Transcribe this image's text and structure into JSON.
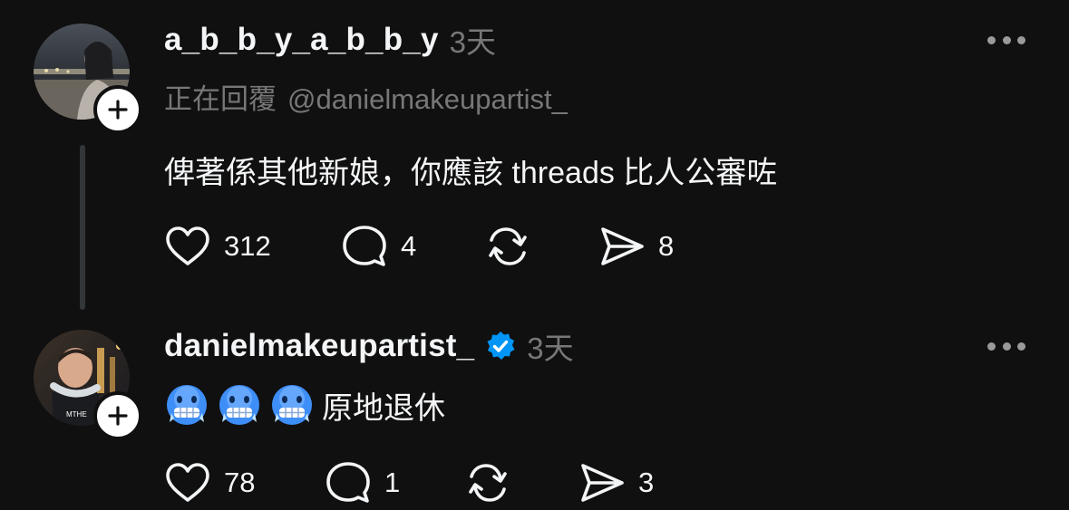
{
  "posts": [
    {
      "username": "a_b_b_y_a_b_b_y",
      "time": "3天",
      "verified": false,
      "replying_label": "正在回覆",
      "replying_handle": "@danielmakeupartist_",
      "content": "俾著係其他新娘，你應該 threads 比人公審咗",
      "likes": "312",
      "comments": "4",
      "reposts": "",
      "shares": "8"
    },
    {
      "username": "danielmakeupartist_",
      "time": "3天",
      "verified": true,
      "emoji": [
        "cold-face",
        "cold-face",
        "cold-face"
      ],
      "content": "原地退休",
      "likes": "78",
      "comments": "1",
      "reposts": "",
      "shares": "3"
    }
  ],
  "icons": {
    "like": "heart-icon",
    "comment": "comment-bubble-icon",
    "repost": "repost-icon",
    "share": "send-icon",
    "more": "more-horizontal-icon",
    "follow": "plus-icon",
    "verified": "verified-badge-icon"
  },
  "colors": {
    "background": "#101010",
    "text": "#f3f5f7",
    "secondary": "#777777",
    "verified": "#0095f6",
    "thread_line": "#333638"
  }
}
